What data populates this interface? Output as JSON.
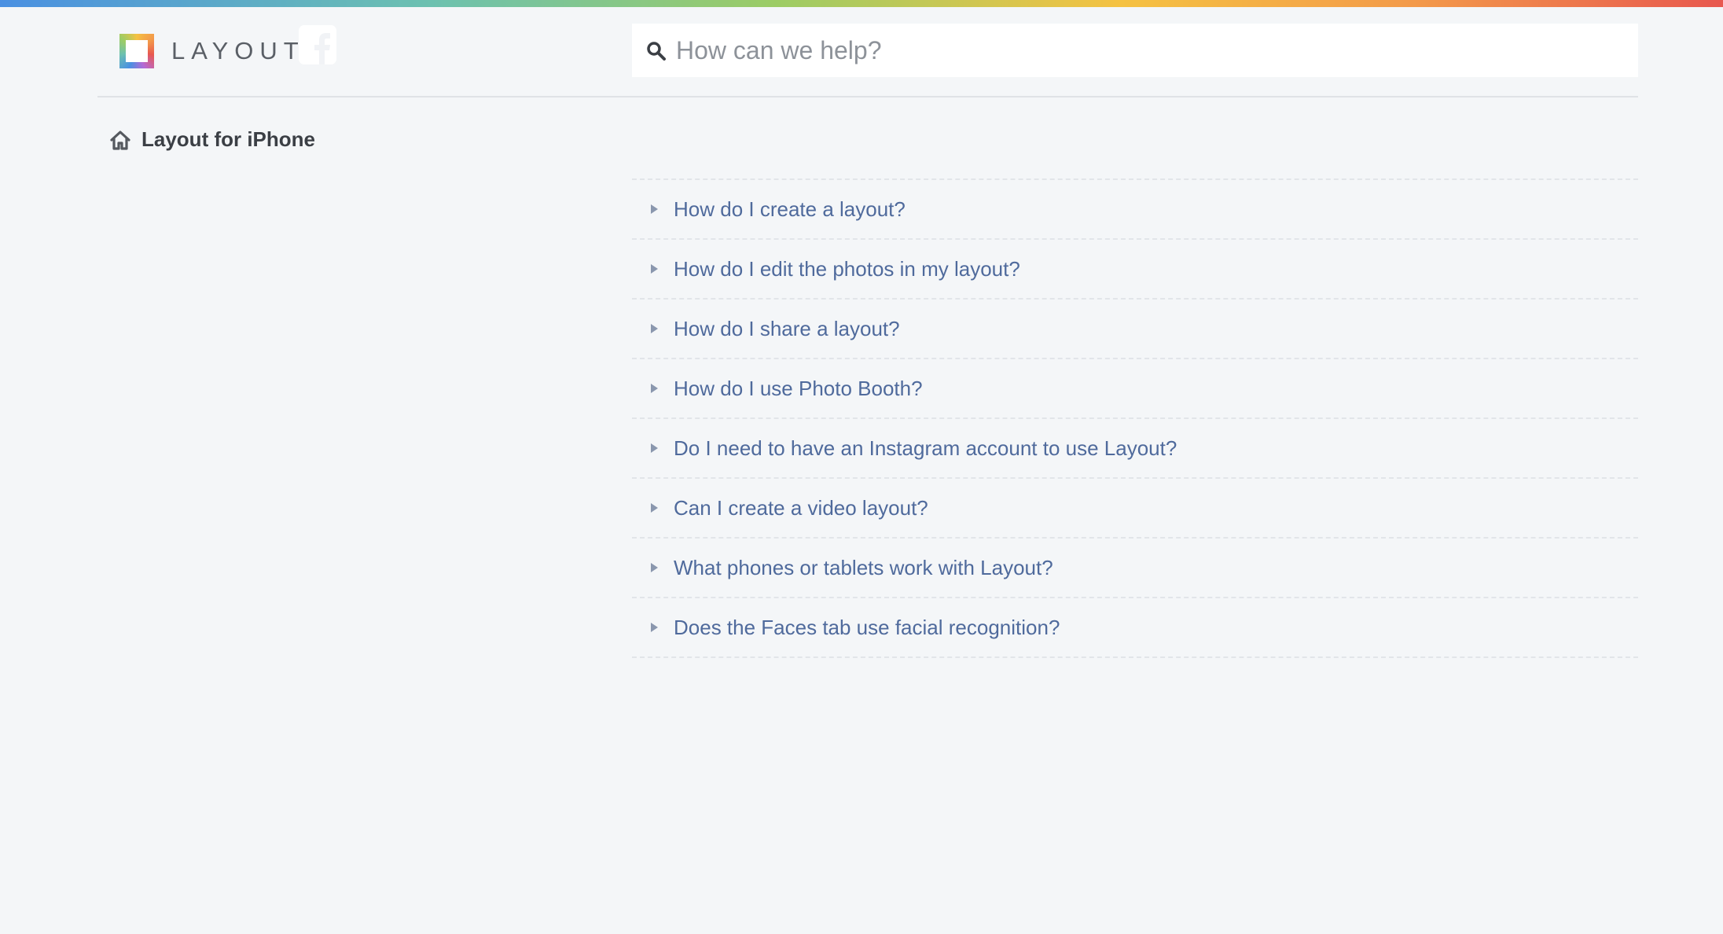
{
  "brand": {
    "name": "LAYOUT",
    "stripe_colors": [
      "#4a90e2",
      "#6cc1b0",
      "#9ccc65",
      "#f5c242",
      "#f39a4a",
      "#e8584f"
    ]
  },
  "header": {
    "facebook_icon": "facebook-icon",
    "search": {
      "placeholder": "How can we help?",
      "value": "",
      "icon": "search-icon"
    }
  },
  "breadcrumb": {
    "icon": "home-icon",
    "label": "Layout for iPhone"
  },
  "faq": {
    "items": [
      {
        "question": "How do I create a layout?"
      },
      {
        "question": "How do I edit the photos in my layout?"
      },
      {
        "question": "How do I share a layout?"
      },
      {
        "question": "How do I use Photo Booth?"
      },
      {
        "question": "Do I need to have an Instagram account to use Layout?"
      },
      {
        "question": "Can I create a video layout?"
      },
      {
        "question": "What phones or tablets work with Layout?"
      },
      {
        "question": "Does the Faces tab use facial recognition?"
      }
    ]
  },
  "colors": {
    "background": "#f4f6f8",
    "link": "#4f6a9c",
    "heading": "#3b3f45"
  }
}
